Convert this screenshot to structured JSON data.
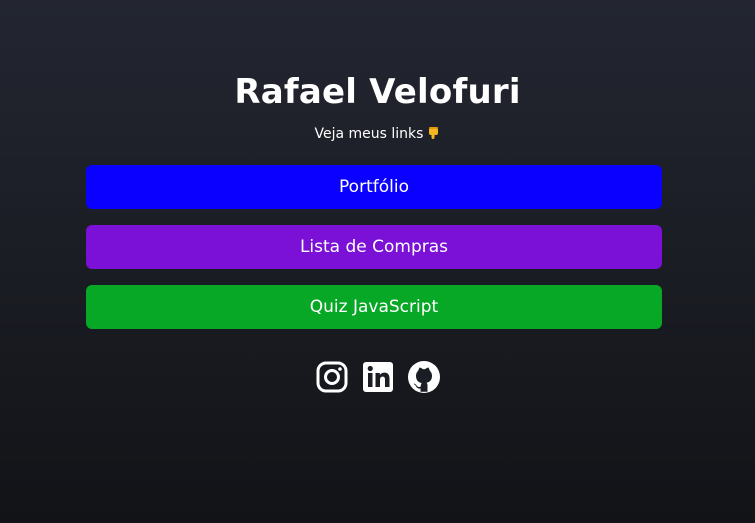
{
  "profile": {
    "name": "Rafael Velofuri",
    "subtitle": "Veja meus links"
  },
  "links": [
    {
      "label": "Portfólio",
      "color": "#0a00ff"
    },
    {
      "label": "Lista de Compras",
      "color": "#7b10d6"
    },
    {
      "label": "Quiz JavaScript",
      "color": "#07a826"
    }
  ],
  "social": [
    {
      "icon": "instagram-icon"
    },
    {
      "icon": "linkedin-icon"
    },
    {
      "icon": "github-icon"
    }
  ]
}
